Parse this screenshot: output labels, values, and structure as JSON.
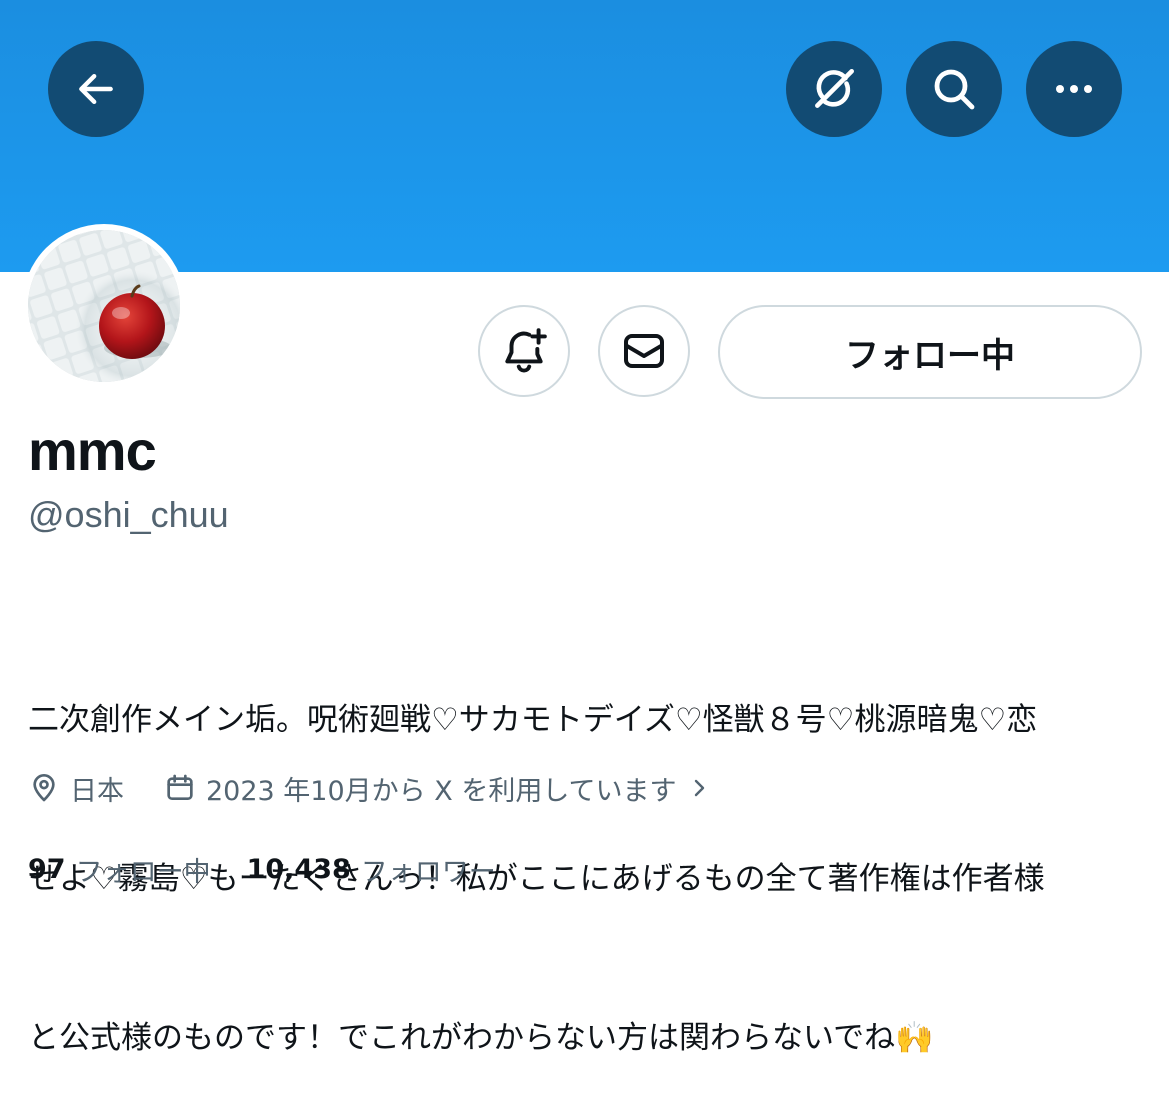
{
  "header": {
    "buttons": {
      "back": "arrow-left-icon",
      "grok": "grok-icon",
      "search": "search-icon",
      "more": "more-horizontal-icon"
    },
    "banner_color": "#1d9bf0",
    "button_color": "#124b73"
  },
  "profile": {
    "avatar_icon": "apple-on-tiles-avatar",
    "notify_icon": "bell-plus-icon",
    "message_icon": "envelope-icon",
    "follow_button_label": "フォロー中",
    "name": "mmc",
    "handle": "@oshi_chuu",
    "bio_lines": [
      "二次創作メイン垢。呪術廻戦♡サカモトデイズ♡怪獣８号♡桃源暗鬼♡恋",
      "せよ♡霧島♡もーたくさんっ！私がここにあげるもの全て著作権は作者様",
      "と公式様のものです！でこれがわからない方は関わらないでね🙌"
    ],
    "location": "日本",
    "joined": "2023 年10月から X を利用しています",
    "following_count": "97",
    "following_label": "フォロー中",
    "followers_count": "10,438",
    "followers_label": "フォロワー"
  }
}
